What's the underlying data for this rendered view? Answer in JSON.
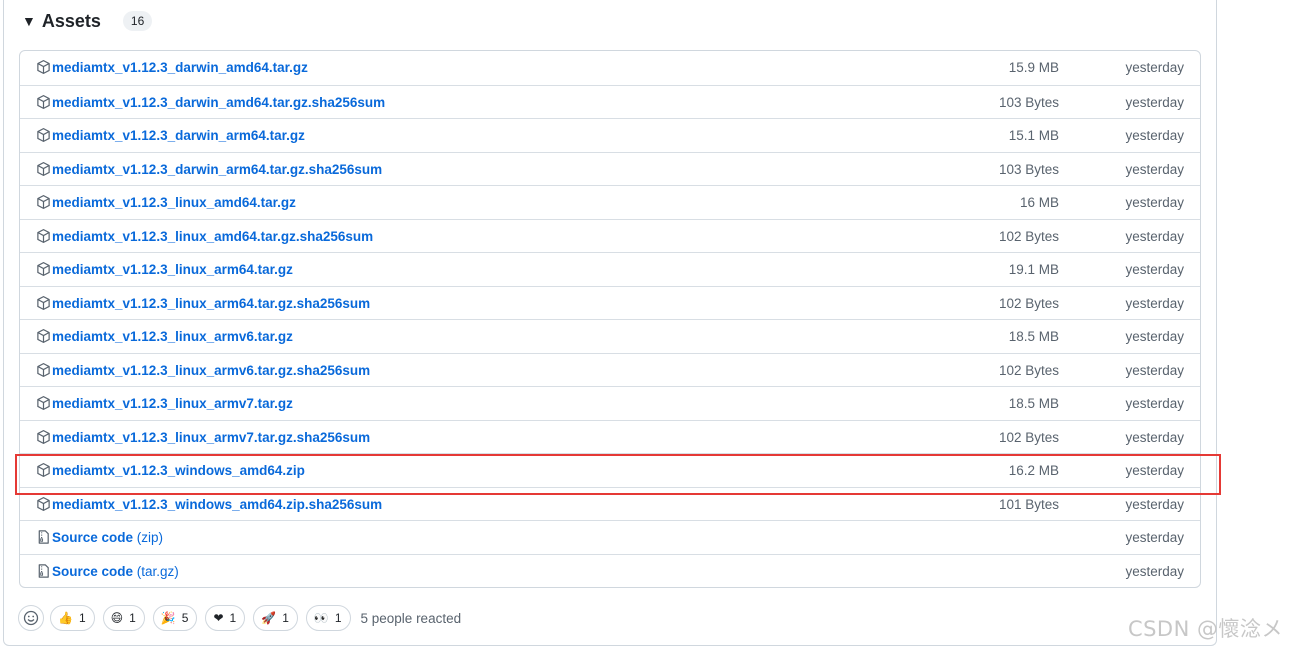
{
  "assets": {
    "title": "Assets",
    "count": "16",
    "items": [
      {
        "name": "mediamtx_v1.12.3_darwin_amd64.tar.gz",
        "size": "15.9 MB",
        "time": "yesterday",
        "icon": "package-icon"
      },
      {
        "name": "mediamtx_v1.12.3_darwin_amd64.tar.gz.sha256sum",
        "size": "103 Bytes",
        "time": "yesterday",
        "icon": "package-icon"
      },
      {
        "name": "mediamtx_v1.12.3_darwin_arm64.tar.gz",
        "size": "15.1 MB",
        "time": "yesterday",
        "icon": "package-icon"
      },
      {
        "name": "mediamtx_v1.12.3_darwin_arm64.tar.gz.sha256sum",
        "size": "103 Bytes",
        "time": "yesterday",
        "icon": "package-icon"
      },
      {
        "name": "mediamtx_v1.12.3_linux_amd64.tar.gz",
        "size": "16 MB",
        "time": "yesterday",
        "icon": "package-icon"
      },
      {
        "name": "mediamtx_v1.12.3_linux_amd64.tar.gz.sha256sum",
        "size": "102 Bytes",
        "time": "yesterday",
        "icon": "package-icon"
      },
      {
        "name": "mediamtx_v1.12.3_linux_arm64.tar.gz",
        "size": "19.1 MB",
        "time": "yesterday",
        "icon": "package-icon"
      },
      {
        "name": "mediamtx_v1.12.3_linux_arm64.tar.gz.sha256sum",
        "size": "102 Bytes",
        "time": "yesterday",
        "icon": "package-icon"
      },
      {
        "name": "mediamtx_v1.12.3_linux_armv6.tar.gz",
        "size": "18.5 MB",
        "time": "yesterday",
        "icon": "package-icon"
      },
      {
        "name": "mediamtx_v1.12.3_linux_armv6.tar.gz.sha256sum",
        "size": "102 Bytes",
        "time": "yesterday",
        "icon": "package-icon"
      },
      {
        "name": "mediamtx_v1.12.3_linux_armv7.tar.gz",
        "size": "18.5 MB",
        "time": "yesterday",
        "icon": "package-icon"
      },
      {
        "name": "mediamtx_v1.12.3_linux_armv7.tar.gz.sha256sum",
        "size": "102 Bytes",
        "time": "yesterday",
        "icon": "package-icon"
      },
      {
        "name": "mediamtx_v1.12.3_windows_amd64.zip",
        "size": "16.2 MB",
        "time": "yesterday",
        "icon": "package-icon"
      },
      {
        "name": "mediamtx_v1.12.3_windows_amd64.zip.sha256sum",
        "size": "101 Bytes",
        "time": "yesterday",
        "icon": "package-icon"
      },
      {
        "name": "Source code",
        "ext": "(zip)",
        "size": "",
        "time": "yesterday",
        "icon": "file-zip-icon"
      },
      {
        "name": "Source code",
        "ext": "(tar.gz)",
        "size": "",
        "time": "yesterday",
        "icon": "file-zip-icon"
      }
    ]
  },
  "reactions": {
    "items": [
      {
        "emoji": "👍",
        "count": "1",
        "icon": "thumbs-up-icon"
      },
      {
        "emoji": "😄",
        "count": "1",
        "icon": "laugh-icon"
      },
      {
        "emoji": "🎉",
        "count": "5",
        "icon": "hooray-icon"
      },
      {
        "emoji": "❤",
        "count": "1",
        "icon": "heart-icon"
      },
      {
        "emoji": "🚀",
        "count": "1",
        "icon": "rocket-icon"
      },
      {
        "emoji": "👀",
        "count": "1",
        "icon": "eyes-icon"
      }
    ],
    "summary": "5 people reacted"
  },
  "watermark": "CSDN @懷淰メ",
  "colors": {
    "link": "#0969da",
    "highlight": "#e53935",
    "muted": "#59636e",
    "border": "#d0d7de"
  }
}
